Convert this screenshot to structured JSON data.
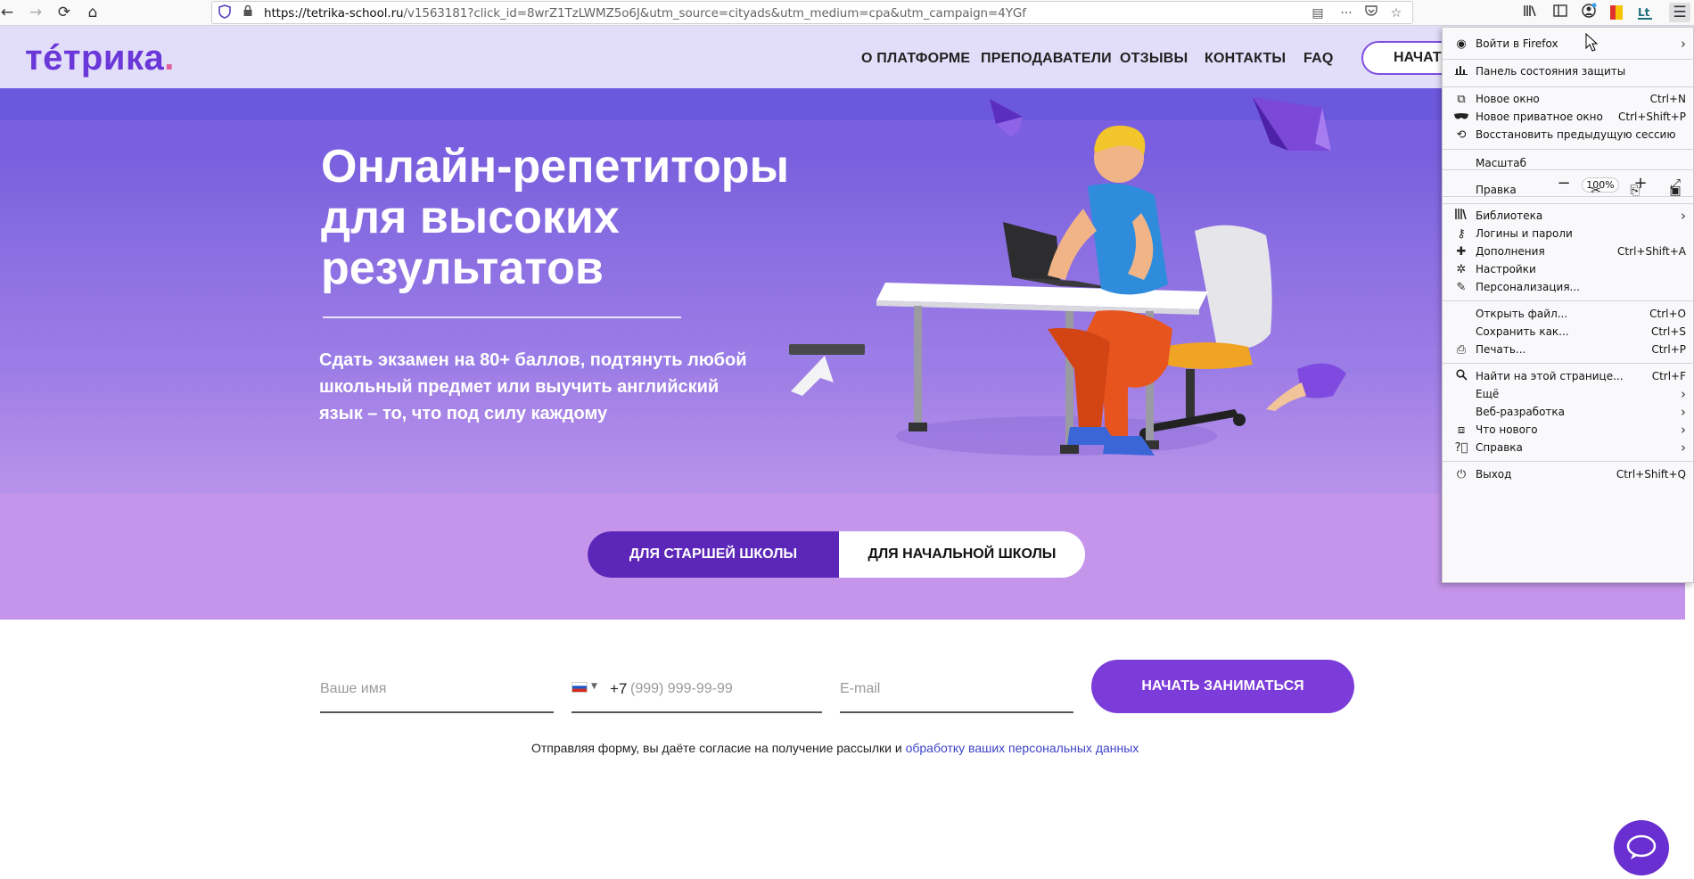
{
  "browser": {
    "url_host": "https://tetrika-school.ru",
    "url_rest": "/v1563181?click_id=8wrZ1TzLWMZ5o6J&utm_source=cityads&utm_medium=cpa&utm_campaign=4YGf"
  },
  "site": {
    "logo": "тéтрика",
    "logo_dot": ".",
    "nav": [
      "О ПЛАТФОРМЕ",
      "ПРЕПОДАВАТЕЛИ",
      "ОТЗЫВЫ",
      "КОНТАКТЫ",
      "FAQ"
    ],
    "header_cta": "НАЧАТЬ"
  },
  "hero": {
    "title": "Онлайн-репетиторы для высоких результатов",
    "subtitle": "Сдать экзамен на 80+ баллов, подтянуть любой школьный предмет или выучить английский язык – то, что под силу каждому",
    "toggle_high": "ДЛЯ СТАРШЕЙ ШКОЛЫ",
    "toggle_primary": "ДЛЯ НАЧАЛЬНОЙ ШКОЛЫ"
  },
  "form": {
    "name_placeholder": "Ваше имя",
    "phone_code": "+7",
    "phone_placeholder": "(999) 999-99-99",
    "email_placeholder": "E-mail",
    "submit": "НАЧАТЬ ЗАНИМАТЬСЯ",
    "consent_text": "Отправляя форму, вы даёте согласие на получение рассылки и ",
    "consent_link": "обработку ваших персональных данных"
  },
  "menu": {
    "signin": "Войти в Firefox",
    "protection": "Панель состояния защиты",
    "new_window": "Новое окно",
    "new_window_sc": "Ctrl+N",
    "private_window": "Новое приватное окно",
    "private_window_sc": "Ctrl+Shift+P",
    "restore": "Восстановить предыдущую сессию",
    "zoom_label": "Масштаб",
    "zoom_value": "100%",
    "edit_label": "Правка",
    "library": "Библиотека",
    "logins": "Логины и пароли",
    "addons": "Дополнения",
    "addons_sc": "Ctrl+Shift+A",
    "settings": "Настройки",
    "customize": "Персонализация...",
    "open_file": "Открыть файл...",
    "open_file_sc": "Ctrl+O",
    "save_as": "Сохранить как...",
    "save_as_sc": "Ctrl+S",
    "print": "Печать...",
    "print_sc": "Ctrl+P",
    "find": "Найти на этой странице...",
    "find_sc": "Ctrl+F",
    "more": "Ещё",
    "webdev": "Веб-разработка",
    "whats_new": "Что нового",
    "help": "Справка",
    "exit": "Выход",
    "exit_sc": "Ctrl+Shift+Q"
  },
  "colors": {
    "brand": "#6a37d9",
    "toggle_active": "#5c27b8",
    "submit": "#7c3cd9"
  }
}
